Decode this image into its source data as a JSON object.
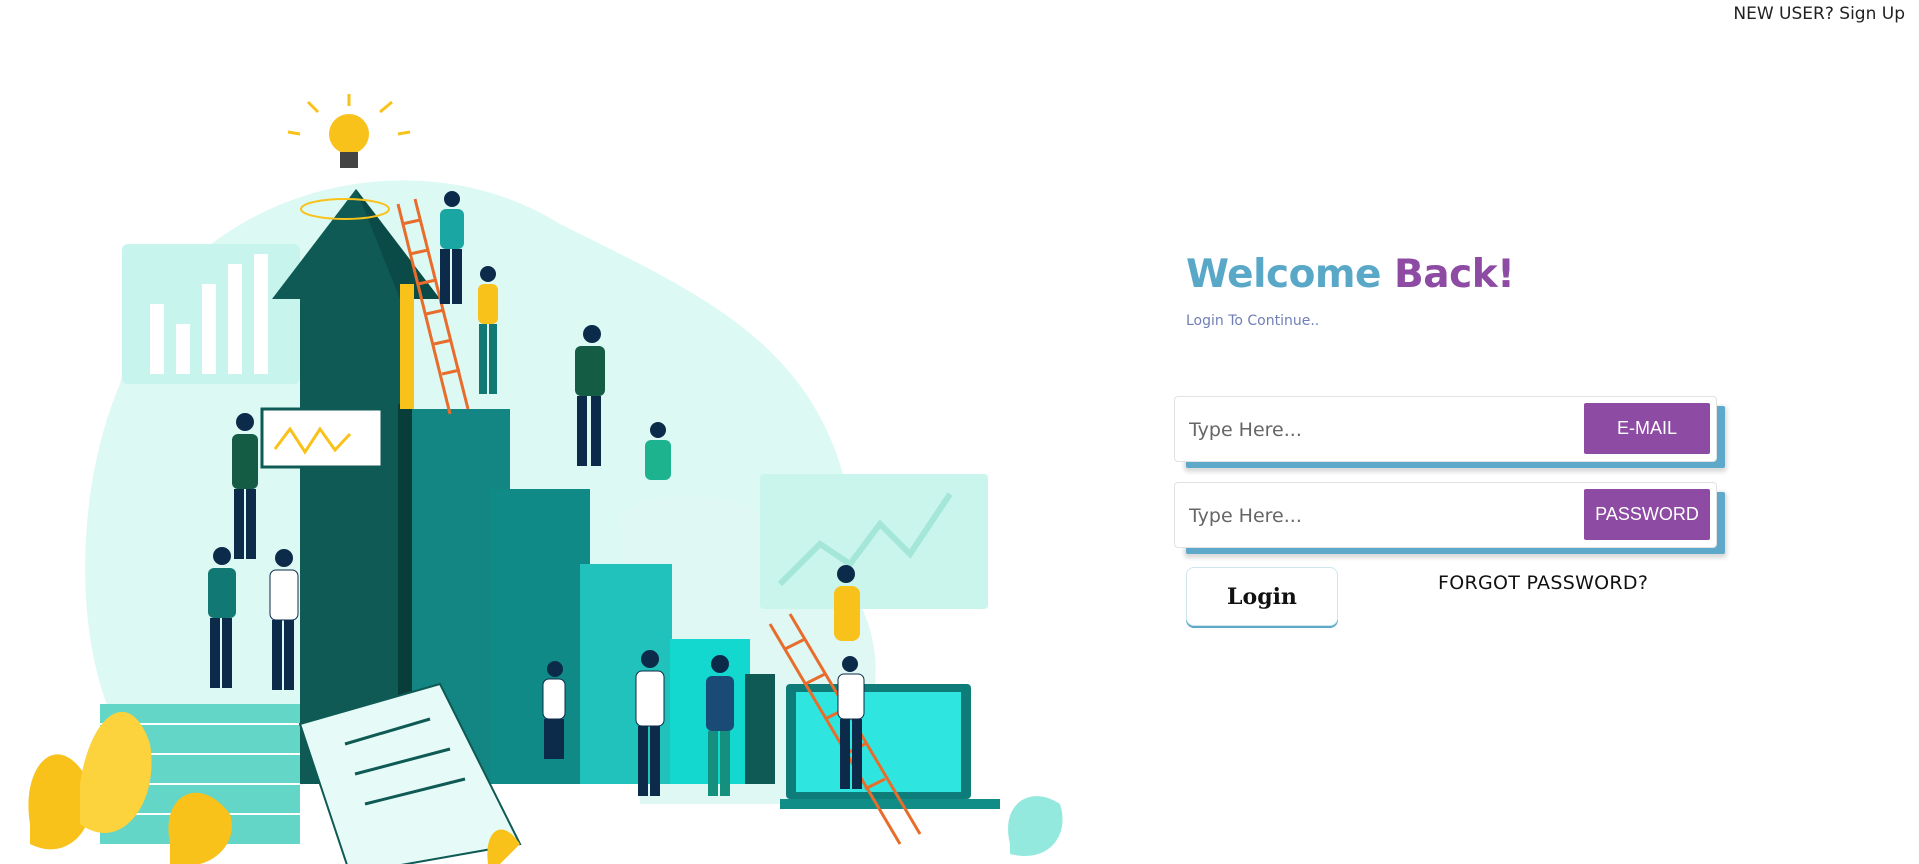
{
  "header": {
    "new_user_text": "NEW USER?",
    "signup_label": "Sign Up"
  },
  "welcome": {
    "title_part1": "Welcome",
    "title_part2": "Back!",
    "subtitle": "Login To Continue.."
  },
  "form": {
    "email": {
      "placeholder": "Type Here...",
      "value": "",
      "tag": "E-MAIL"
    },
    "password": {
      "placeholder": "Type Here...",
      "value": "",
      "tag": "PASSWORD"
    },
    "login_label": "Login",
    "forgot_label": "FORGOT PASSWORD?"
  },
  "colors": {
    "accent_blue": "#5aa8c8",
    "accent_purple": "#8e4ba3",
    "teal_dark": "#0f5a55",
    "teal_light": "#b8f1e9",
    "yellow": "#f8c21a"
  },
  "icons": {
    "illustration": "growth-teamwork-illustration",
    "lightbulb": "lightbulb-icon"
  }
}
